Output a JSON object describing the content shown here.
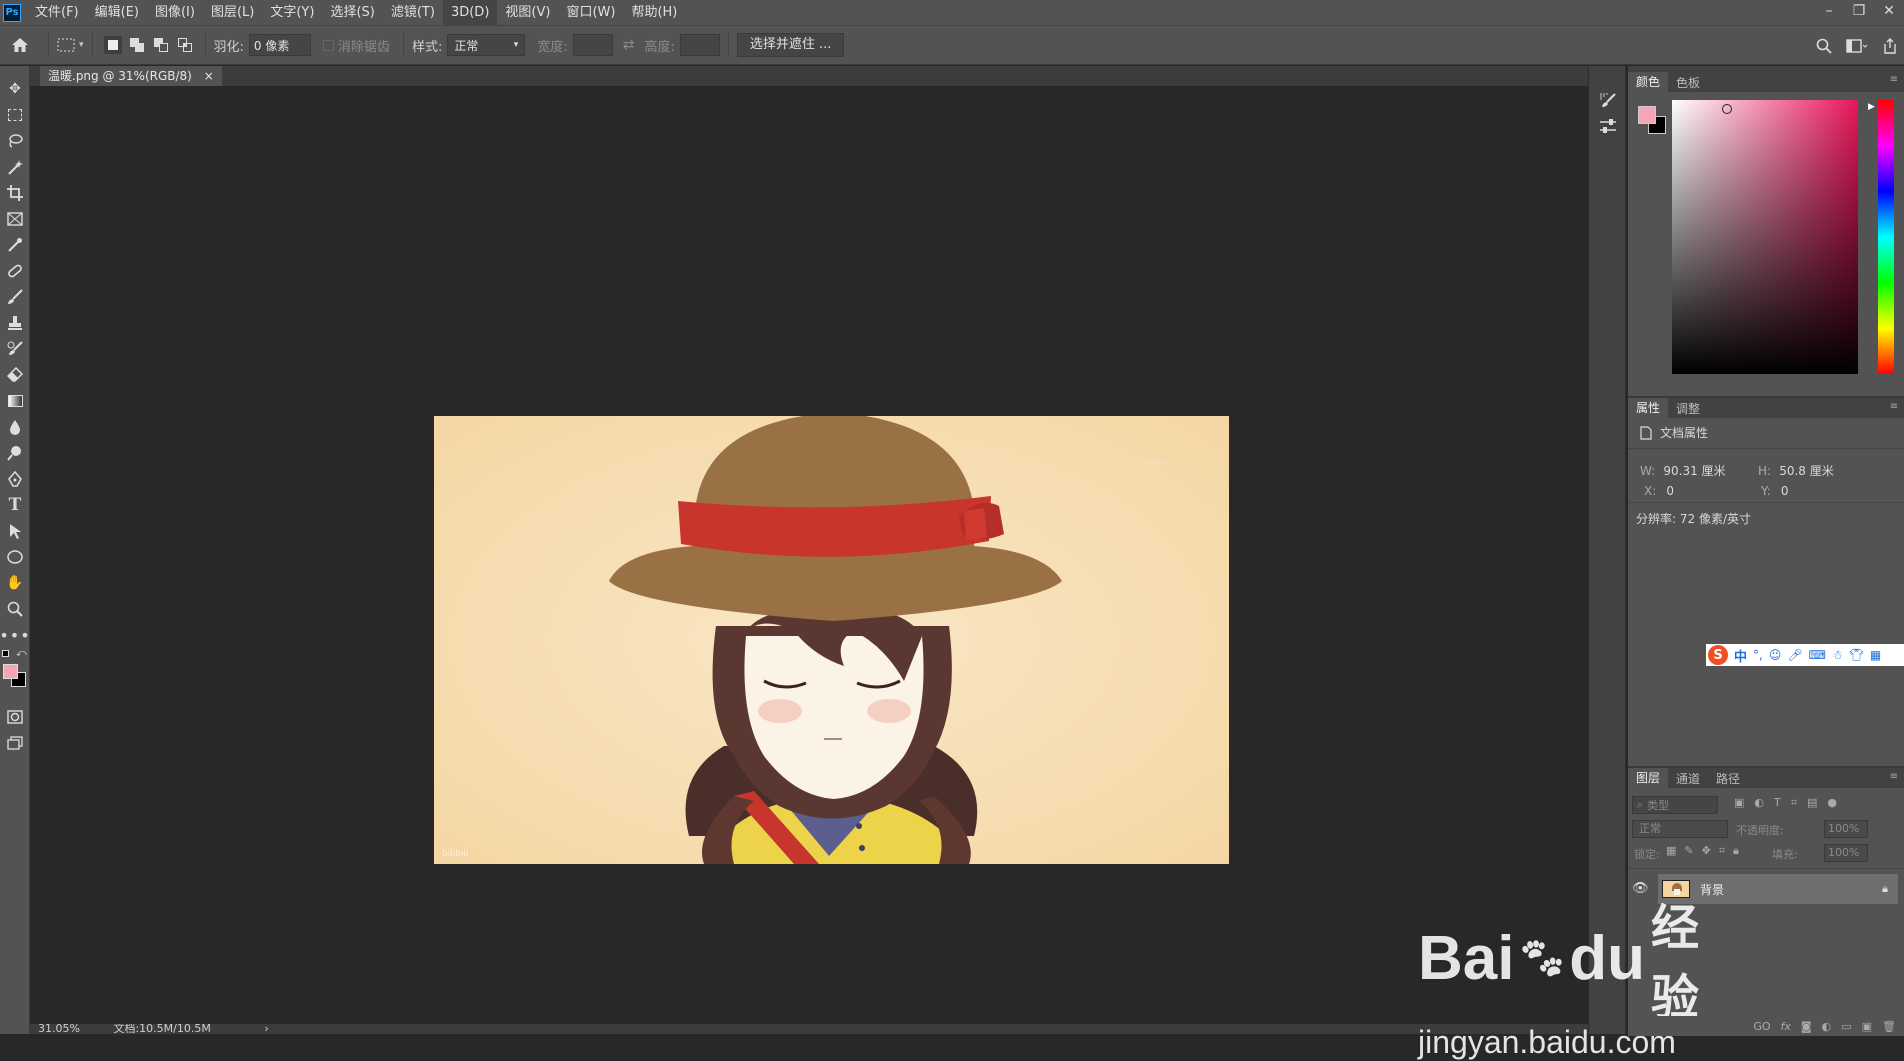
{
  "menubar": {
    "logo": "Ps",
    "items": [
      "文件(F)",
      "编辑(E)",
      "图像(I)",
      "图层(L)",
      "文字(Y)",
      "选择(S)",
      "滤镜(T)",
      "3D(D)",
      "视图(V)",
      "窗口(W)",
      "帮助(H)"
    ],
    "window_controls": [
      "–",
      "❐",
      "✕"
    ]
  },
  "options": {
    "feather_label": "羽化:",
    "feather_value": "0 像素",
    "antialias_label": "消除锯齿",
    "style_label": "样式:",
    "style_value": "正常",
    "width_label": "宽度:",
    "height_label": "高度:",
    "select_mask_button": "选择并遮住 ..."
  },
  "document": {
    "tab_title": "温暖.png @ 31%(RGB/8)",
    "close": "×",
    "watermark_top": "·· ·· ··",
    "watermark_bottom": "bilibili"
  },
  "status": {
    "zoom": "31.05%",
    "doc_info": "文档:10.5M/10.5M",
    "arrow": "›"
  },
  "color_panel": {
    "tabs": [
      "颜色",
      "色板"
    ],
    "foreground": "#f4a6b8",
    "background": "#000000",
    "hue_color": "#e8165a"
  },
  "properties_panel": {
    "tabs": [
      "属性",
      "调整"
    ],
    "section": "文档属性",
    "w_label": "W:",
    "w_value": "90.31 厘米",
    "h_label": "H:",
    "h_value": "50.8 厘米",
    "x_label": "X:",
    "x_value": "0",
    "y_label": "Y:",
    "y_value": "0",
    "resolution": "分辨率: 72 像素/英寸"
  },
  "ime_bar": {
    "logo": "S",
    "lang": "中"
  },
  "layers_panel": {
    "tabs": [
      "图层",
      "通道",
      "路径"
    ],
    "filter_placeholder": "类型",
    "blend_mode": "正常",
    "opacity_label": "不透明度:",
    "opacity_value": "100%",
    "lock_label": "锁定:",
    "fill_label": "填充:",
    "fill_value": "100%",
    "layer_name": "背景",
    "bottom_icons": [
      "GO",
      "fx"
    ]
  },
  "baidu_watermark": {
    "brand": "Bai",
    "brand2": "du",
    "suffix": "经验",
    "url": "jingyan.baidu.com"
  }
}
